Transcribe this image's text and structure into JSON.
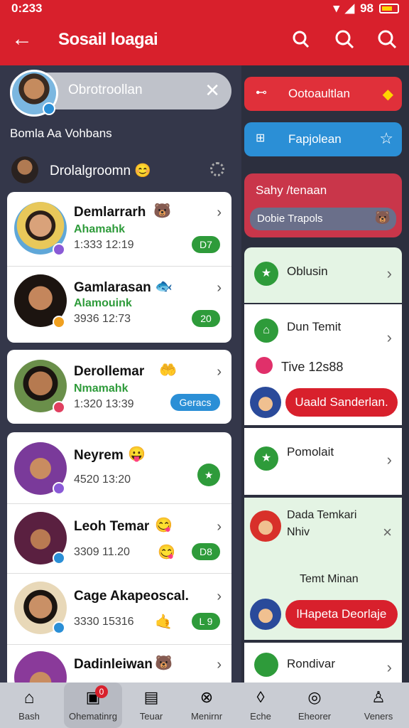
{
  "status_bar": {
    "time": "0:233",
    "battery_text": "98"
  },
  "app_bar": {
    "title": "Sosail loagai"
  },
  "search": {
    "value": "Obrotroollan"
  },
  "section_heading": "Bomla Aa Vohbans",
  "my_status": {
    "label": "Drolalgroomn",
    "emoji": "😊"
  },
  "chats": [
    {
      "name": "Demlarrarh",
      "subtitle": "Ahamahk",
      "time": "1:333 12:19",
      "pill": "D7",
      "pill_color": "#2e9b3a",
      "emoji": "🐻"
    },
    {
      "name": "Gamlarasan",
      "subtitle": "Alamouink",
      "time": "3936 12:73",
      "pill": "20",
      "pill_color": "#2e9b3a",
      "emoji": "🐟"
    },
    {
      "name": "Derollemar",
      "subtitle": "Nmamahk",
      "time": "1:320 13:39",
      "pill": "Geracs",
      "pill_color": "#2b8fd6",
      "emoji": "🤲"
    },
    {
      "name": "Neyrem",
      "subtitle": "",
      "time": "4520 13:20",
      "pill": "★",
      "pill_color": "#2e9b3a",
      "emoji": "😛"
    },
    {
      "name": "Leoh Temar",
      "subtitle": "",
      "time": "3309 11.20",
      "pill": "D8",
      "pill_color": "#2e9b3a",
      "emoji": "😋"
    },
    {
      "name": "Cage Akapeoscal.",
      "subtitle": "",
      "time": "3330 15316",
      "pill": "L 9",
      "pill_color": "#2e9b3a",
      "emoji": "🤙"
    },
    {
      "name": "Dadinleiwan",
      "subtitle": "",
      "time": "",
      "pill": "",
      "pill_color": "#2e9b3a",
      "emoji": "🐻"
    }
  ],
  "right_panel": {
    "pill1": "Ootoaultlan",
    "pill2": "Fapjolean",
    "banner_title": "Sahy /tenaan",
    "banner_sub": "Dobie Trapols",
    "item1": "Oblusin",
    "item2": "Dun Temit",
    "item2_sub": "Tive 12s88",
    "button1": "Uaald Sanderlan.",
    "item3": "Pomolait",
    "item4": "Dada Temkari",
    "item4_sub": "Nhiv",
    "item4_mid": "Temt Minan",
    "button2": "lHapeta Deorlaje",
    "item5": "Rondivar"
  },
  "nav": [
    {
      "label": "Bash"
    },
    {
      "label": "Ohematinrg"
    },
    {
      "label": "Teuar"
    },
    {
      "label": "Menirnr"
    },
    {
      "label": "Eche"
    },
    {
      "label": "Eheorer"
    },
    {
      "label": "Veners"
    }
  ],
  "nav_badge": "0",
  "colors": {
    "brand_red": "#d8202c",
    "blue": "#2b8fd6",
    "green": "#2e9b3a"
  }
}
